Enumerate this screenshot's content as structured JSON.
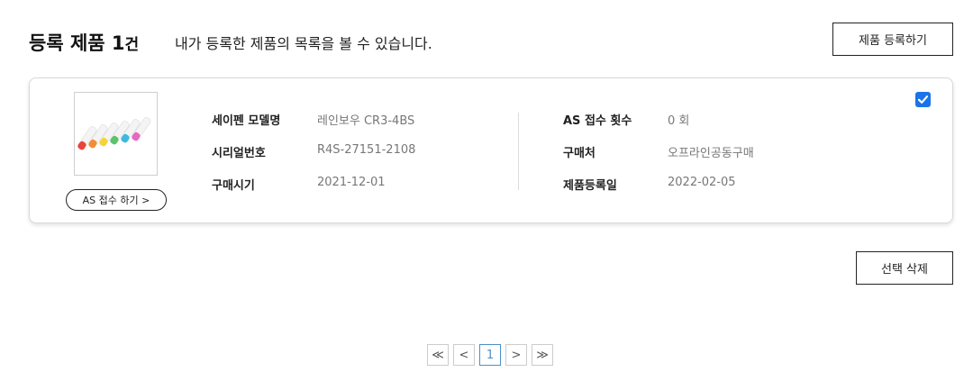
{
  "header": {
    "title_prefix": "등록 제품 ",
    "count": "1",
    "count_unit": "건",
    "subtitle": "내가 등록한 제품의 목록을 볼 수 있습니다.",
    "register_button": "제품 등록하기"
  },
  "product": {
    "as_button": "AS 접수 하기 >",
    "checked": true,
    "left": [
      {
        "label": "세이펜 모델명",
        "value": "레인보우 CR3-4BS"
      },
      {
        "label": "시리얼번호",
        "value": "R4S-27151-2108"
      },
      {
        "label": "구매시기",
        "value": "2021-12-01"
      }
    ],
    "right": [
      {
        "label": "AS 접수 횟수",
        "value": "0 회"
      },
      {
        "label": "구매처",
        "value": "오프라인공동구매"
      },
      {
        "label": "제품등록일",
        "value": "2022-02-05"
      }
    ],
    "pen_colors": [
      "#e8453c",
      "#f28c38",
      "#f5d33b",
      "#5cc26b",
      "#3fb8e0",
      "#e667c4"
    ]
  },
  "actions": {
    "delete_button": "선택 삭제"
  },
  "pagination": {
    "first": "≪",
    "prev": "<",
    "current": "1",
    "next": ">",
    "last": "≫"
  },
  "colors": {
    "checkbox": "#1a73e8",
    "page_active": "#4a90c8"
  }
}
